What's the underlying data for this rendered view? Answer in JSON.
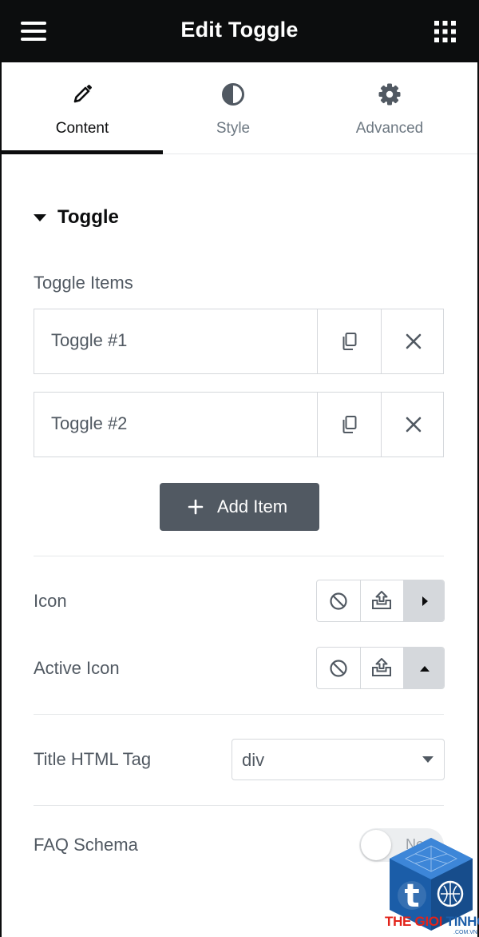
{
  "header": {
    "title": "Edit Toggle",
    "menu_icon": "hamburger-menu-icon",
    "apps_icon": "grid-apps-icon"
  },
  "tabs": [
    {
      "label": "Content",
      "icon": "pencil-icon",
      "active": true
    },
    {
      "label": "Style",
      "icon": "half-circle-icon",
      "active": false
    },
    {
      "label": "Advanced",
      "icon": "gear-icon",
      "active": false
    }
  ],
  "section": {
    "title": "Toggle",
    "expanded": true
  },
  "toggle_items": {
    "label": "Toggle Items",
    "items": [
      {
        "title": "Toggle #1"
      },
      {
        "title": "Toggle #2"
      }
    ],
    "add_label": "Add Item"
  },
  "icon_control": {
    "label": "Icon",
    "options": [
      "none-icon",
      "upload-icon",
      "caret-right-icon"
    ]
  },
  "active_icon_control": {
    "label": "Active Icon",
    "options": [
      "none-icon",
      "upload-icon",
      "caret-up-icon"
    ]
  },
  "title_tag": {
    "label": "Title HTML Tag",
    "value": "div"
  },
  "faq_schema": {
    "label": "FAQ Schema",
    "state_text": "No",
    "enabled": false
  },
  "watermark": {
    "brand_part1": "THE GIOI ",
    "brand_part2": "TINHOC",
    "domain": ".COM.VN",
    "logo_letter": "t"
  },
  "colors": {
    "header_bg": "#0c0d0e",
    "text": "#515962",
    "button_bg": "#515962",
    "border": "#d5d8dc",
    "active_option_bg": "#d5d8dc"
  }
}
